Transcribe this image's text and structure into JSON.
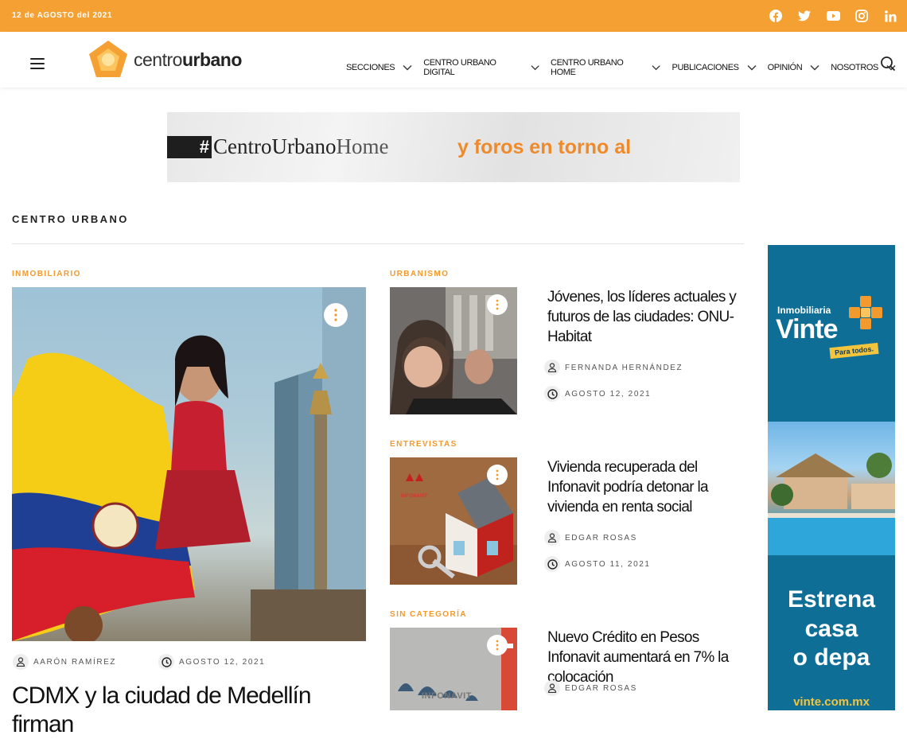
{
  "topbar": {
    "date": "12 de AGOSTO del 2021",
    "social": [
      "facebook-icon",
      "twitter-icon",
      "youtube-icon",
      "instagram-icon",
      "linkedin-icon"
    ]
  },
  "header": {
    "logo_light": "centro",
    "logo_bold": "urbano",
    "nav": [
      "SECCIONES",
      "CENTRO URBANO DIGITAL",
      "CENTRO URBANO HOME",
      "PUBLICACIONES",
      "OPINIÓN",
      "NOSOTROS"
    ]
  },
  "banner": {
    "hash": "#",
    "brand": "CentroUrbano",
    "brand_suffix": "Home",
    "tagline": "y foros en torno al"
  },
  "section": {
    "title": "CENTRO URBANO"
  },
  "feature": {
    "category": "INMOBILIARIO",
    "author": "AARÓN RAMÍREZ",
    "date": "AGOSTO 12, 2021",
    "title": "CDMX y la ciudad de Medellín firman"
  },
  "posts": [
    {
      "category": "URBANISMO",
      "title": "Jóvenes, los líderes actuales y futuros de las ciudades: ONU-Habitat",
      "author": "FERNANDA HERNÁNDEZ",
      "date": "AGOSTO 12, 2021"
    },
    {
      "category": "ENTREVISTAS",
      "title": "Vivienda recuperada del Infonavit podría detonar la vivienda en renta social",
      "author": "EDGAR ROSAS",
      "date": "AGOSTO 11, 2021",
      "thumb_label": "INFONAVIT"
    },
    {
      "category": "SIN CATEGORÍA",
      "title": "Nuevo Crédito en Pesos Infonavit aumentará en 7% la colocación",
      "author": "EDGAR ROSAS",
      "thumb_label": "INFONAVIT"
    }
  ],
  "side_ad": {
    "small": "Inmobiliaria",
    "big": "Vinte",
    "tag": "Para todos.",
    "estrena": [
      "Estrena",
      "casa",
      "o depa"
    ],
    "url": "vinte.com.mx"
  },
  "colors": {
    "accent": "#f5a033",
    "category": "#f39a2e",
    "ad_blue": "#0e6e96"
  }
}
